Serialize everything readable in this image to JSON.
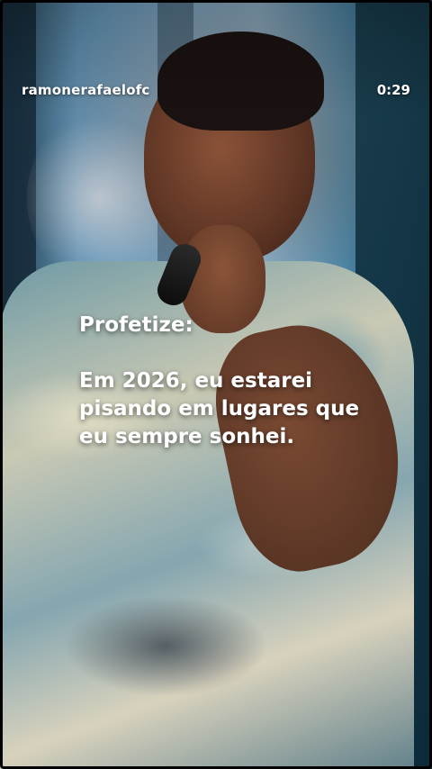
{
  "header": {
    "username": "ramonerafaelofc",
    "time": "0:29"
  },
  "caption": {
    "line1": "Profetize:",
    "line2": "Em 2026, eu estarei",
    "line3": "pisando em lugares que",
    "line4": "eu sempre sonhei."
  }
}
